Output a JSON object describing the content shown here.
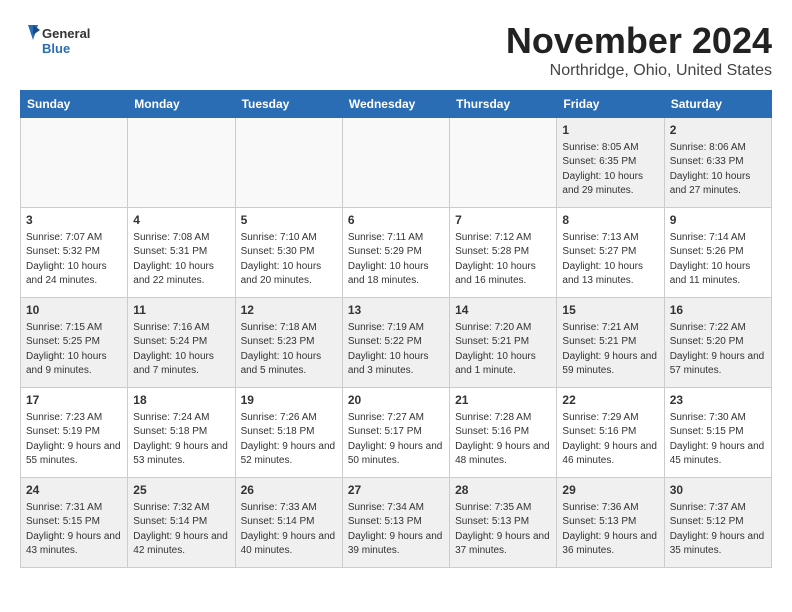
{
  "header": {
    "logo_general": "General",
    "logo_blue": "Blue",
    "month_title": "November 2024",
    "location": "Northridge, Ohio, United States"
  },
  "weekdays": [
    "Sunday",
    "Monday",
    "Tuesday",
    "Wednesday",
    "Thursday",
    "Friday",
    "Saturday"
  ],
  "weeks": [
    [
      {
        "day": "",
        "info": ""
      },
      {
        "day": "",
        "info": ""
      },
      {
        "day": "",
        "info": ""
      },
      {
        "day": "",
        "info": ""
      },
      {
        "day": "",
        "info": ""
      },
      {
        "day": "1",
        "info": "Sunrise: 8:05 AM\nSunset: 6:35 PM\nDaylight: 10 hours and 29 minutes."
      },
      {
        "day": "2",
        "info": "Sunrise: 8:06 AM\nSunset: 6:33 PM\nDaylight: 10 hours and 27 minutes."
      }
    ],
    [
      {
        "day": "3",
        "info": "Sunrise: 7:07 AM\nSunset: 5:32 PM\nDaylight: 10 hours and 24 minutes."
      },
      {
        "day": "4",
        "info": "Sunrise: 7:08 AM\nSunset: 5:31 PM\nDaylight: 10 hours and 22 minutes."
      },
      {
        "day": "5",
        "info": "Sunrise: 7:10 AM\nSunset: 5:30 PM\nDaylight: 10 hours and 20 minutes."
      },
      {
        "day": "6",
        "info": "Sunrise: 7:11 AM\nSunset: 5:29 PM\nDaylight: 10 hours and 18 minutes."
      },
      {
        "day": "7",
        "info": "Sunrise: 7:12 AM\nSunset: 5:28 PM\nDaylight: 10 hours and 16 minutes."
      },
      {
        "day": "8",
        "info": "Sunrise: 7:13 AM\nSunset: 5:27 PM\nDaylight: 10 hours and 13 minutes."
      },
      {
        "day": "9",
        "info": "Sunrise: 7:14 AM\nSunset: 5:26 PM\nDaylight: 10 hours and 11 minutes."
      }
    ],
    [
      {
        "day": "10",
        "info": "Sunrise: 7:15 AM\nSunset: 5:25 PM\nDaylight: 10 hours and 9 minutes."
      },
      {
        "day": "11",
        "info": "Sunrise: 7:16 AM\nSunset: 5:24 PM\nDaylight: 10 hours and 7 minutes."
      },
      {
        "day": "12",
        "info": "Sunrise: 7:18 AM\nSunset: 5:23 PM\nDaylight: 10 hours and 5 minutes."
      },
      {
        "day": "13",
        "info": "Sunrise: 7:19 AM\nSunset: 5:22 PM\nDaylight: 10 hours and 3 minutes."
      },
      {
        "day": "14",
        "info": "Sunrise: 7:20 AM\nSunset: 5:21 PM\nDaylight: 10 hours and 1 minute."
      },
      {
        "day": "15",
        "info": "Sunrise: 7:21 AM\nSunset: 5:21 PM\nDaylight: 9 hours and 59 minutes."
      },
      {
        "day": "16",
        "info": "Sunrise: 7:22 AM\nSunset: 5:20 PM\nDaylight: 9 hours and 57 minutes."
      }
    ],
    [
      {
        "day": "17",
        "info": "Sunrise: 7:23 AM\nSunset: 5:19 PM\nDaylight: 9 hours and 55 minutes."
      },
      {
        "day": "18",
        "info": "Sunrise: 7:24 AM\nSunset: 5:18 PM\nDaylight: 9 hours and 53 minutes."
      },
      {
        "day": "19",
        "info": "Sunrise: 7:26 AM\nSunset: 5:18 PM\nDaylight: 9 hours and 52 minutes."
      },
      {
        "day": "20",
        "info": "Sunrise: 7:27 AM\nSunset: 5:17 PM\nDaylight: 9 hours and 50 minutes."
      },
      {
        "day": "21",
        "info": "Sunrise: 7:28 AM\nSunset: 5:16 PM\nDaylight: 9 hours and 48 minutes."
      },
      {
        "day": "22",
        "info": "Sunrise: 7:29 AM\nSunset: 5:16 PM\nDaylight: 9 hours and 46 minutes."
      },
      {
        "day": "23",
        "info": "Sunrise: 7:30 AM\nSunset: 5:15 PM\nDaylight: 9 hours and 45 minutes."
      }
    ],
    [
      {
        "day": "24",
        "info": "Sunrise: 7:31 AM\nSunset: 5:15 PM\nDaylight: 9 hours and 43 minutes."
      },
      {
        "day": "25",
        "info": "Sunrise: 7:32 AM\nSunset: 5:14 PM\nDaylight: 9 hours and 42 minutes."
      },
      {
        "day": "26",
        "info": "Sunrise: 7:33 AM\nSunset: 5:14 PM\nDaylight: 9 hours and 40 minutes."
      },
      {
        "day": "27",
        "info": "Sunrise: 7:34 AM\nSunset: 5:13 PM\nDaylight: 9 hours and 39 minutes."
      },
      {
        "day": "28",
        "info": "Sunrise: 7:35 AM\nSunset: 5:13 PM\nDaylight: 9 hours and 37 minutes."
      },
      {
        "day": "29",
        "info": "Sunrise: 7:36 AM\nSunset: 5:13 PM\nDaylight: 9 hours and 36 minutes."
      },
      {
        "day": "30",
        "info": "Sunrise: 7:37 AM\nSunset: 5:12 PM\nDaylight: 9 hours and 35 minutes."
      }
    ]
  ]
}
